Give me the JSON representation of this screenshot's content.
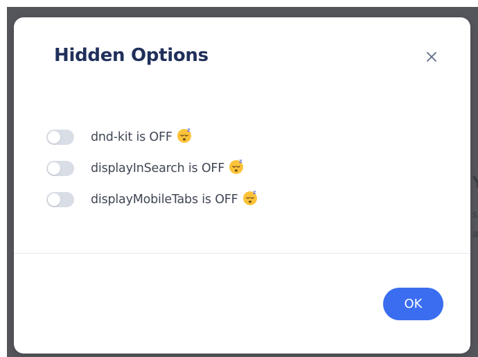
{
  "modal": {
    "title": "Hidden Options",
    "close_label": "×",
    "options": [
      {
        "label": "dnd-kit is OFF",
        "enabled": false,
        "emoji": "sleeping-face"
      },
      {
        "label": "displayInSearch is OFF",
        "enabled": false,
        "emoji": "sleeping-face"
      },
      {
        "label": "displayMobileTabs is OFF",
        "enabled": false,
        "emoji": "sleeping-face"
      }
    ],
    "ok_label": "OK"
  },
  "colors": {
    "backdrop": "#55565c",
    "title": "#20305a",
    "toggle_off": "#d9dde6",
    "accent": "#3a6df0"
  }
}
